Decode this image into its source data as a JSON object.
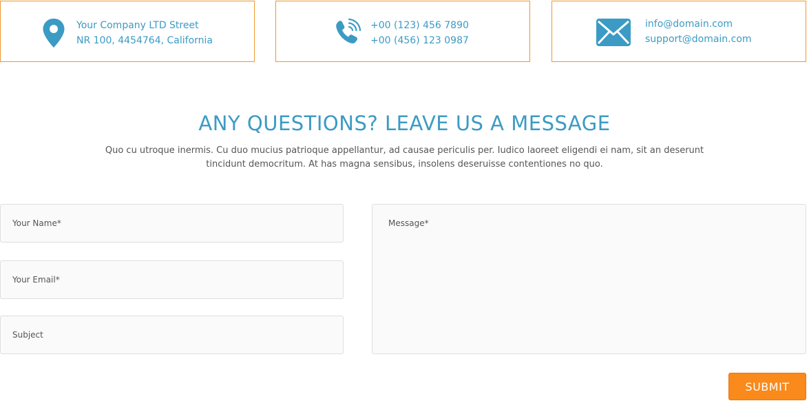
{
  "contact_cards": {
    "address": {
      "icon": "map-pin-icon",
      "line1": "Your Company LTD Street",
      "line2": "NR 100, 4454764, California"
    },
    "phone": {
      "icon": "phone-icon",
      "line1": "+00 (123) 456 7890",
      "line2": "+00 (456) 123 0987"
    },
    "email": {
      "icon": "envelope-icon",
      "line1": "info@domain.com",
      "line2": "support@domain.com"
    }
  },
  "section": {
    "title": "ANY QUESTIONS? LEAVE US A MESSAGE",
    "intro": "Quo cu utroque inermis. Cu duo mucius patrioque appellantur, ad causae periculis per. Iudico laoreet eligendi ei nam, sit an dese­runt tincidunt democritum. At has magna sensibus, insolens deseruisse contentiones no quo."
  },
  "form": {
    "name_placeholder": "Your Name*",
    "email_placeholder": "Your Email*",
    "subject_placeholder": "Subject",
    "message_placeholder": "Message*",
    "submit_label": "SUBMIT"
  },
  "colors": {
    "accent_blue": "#3b9bc4",
    "accent_orange": "#f98a1b",
    "card_border": "#f0962a"
  }
}
